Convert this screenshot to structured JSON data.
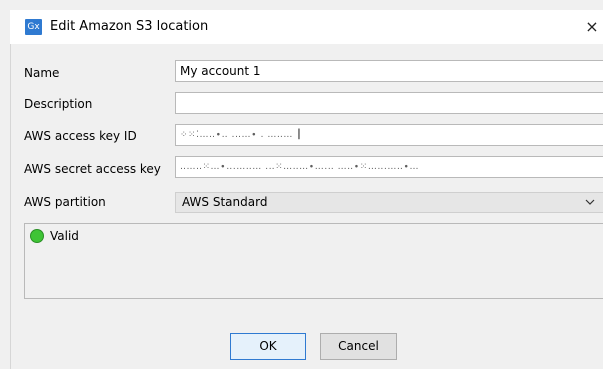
{
  "window": {
    "app_icon_text": "Gx",
    "title": "Edit Amazon S3 location",
    "close_glyph": "×"
  },
  "form": {
    "name": {
      "label": "Name",
      "value": "My account 1"
    },
    "description": {
      "label": "Description",
      "value": ""
    },
    "access_key": {
      "label": "AWS access key ID",
      "value": "⁘⁙⁚…‥∙‥ ․‥…∙ ․ …‥… ┃"
    },
    "secret_key": {
      "label": "AWS secret access key",
      "value": "‥…‥⁙…∙‥․…‥… ․‥⁙…‥…∙…․‥ …‥∙⁙…‥․…‥∙…"
    },
    "partition": {
      "label": "AWS partition",
      "selected": "AWS Standard"
    }
  },
  "status": {
    "text": "Valid",
    "color": "#3fc436"
  },
  "buttons": {
    "ok": "OK",
    "cancel": "Cancel"
  },
  "colors": {
    "accent": "#2f7ad1",
    "title_bg": "#ffffff",
    "dialog_bg": "#f0f0f0"
  }
}
